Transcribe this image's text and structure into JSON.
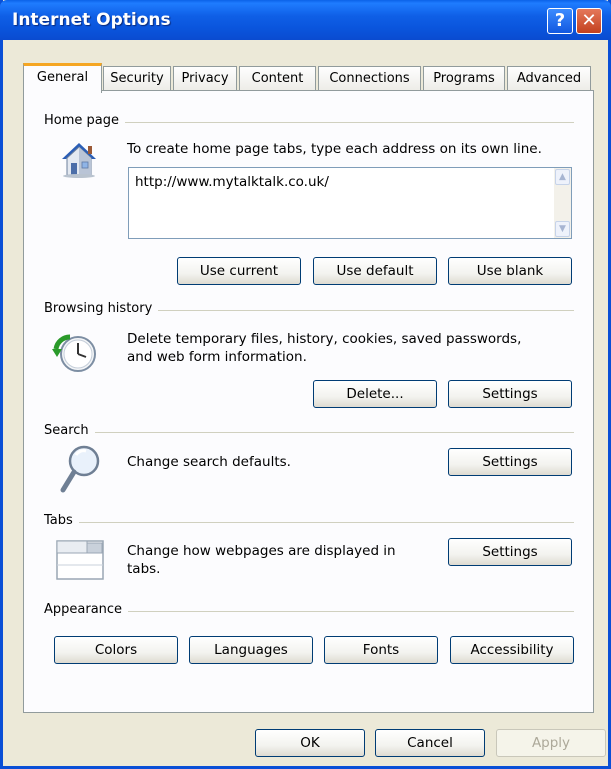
{
  "window": {
    "title": "Internet Options",
    "help_glyph": "?",
    "close_glyph": "✕"
  },
  "tabs": [
    {
      "label": "General"
    },
    {
      "label": "Security"
    },
    {
      "label": "Privacy"
    },
    {
      "label": "Content"
    },
    {
      "label": "Connections"
    },
    {
      "label": "Programs"
    },
    {
      "label": "Advanced"
    }
  ],
  "home_page": {
    "label": "Home page",
    "description": "To create home page tabs, type each address on its own line.",
    "value": "http://www.mytalktalk.co.uk/",
    "buttons": {
      "use_current": "Use current",
      "use_default": "Use default",
      "use_blank": "Use blank"
    }
  },
  "browsing_history": {
    "label": "Browsing history",
    "description_line1": "Delete temporary files, history, cookies, saved passwords,",
    "description_line2": "and web form information.",
    "buttons": {
      "delete": "Delete...",
      "settings": "Settings"
    }
  },
  "search": {
    "label": "Search",
    "description": "Change search defaults.",
    "buttons": {
      "settings": "Settings"
    }
  },
  "tabs_group": {
    "label": "Tabs",
    "description_line1": "Change how webpages are displayed in",
    "description_line2": "tabs.",
    "buttons": {
      "settings": "Settings"
    }
  },
  "appearance": {
    "label": "Appearance",
    "buttons": {
      "colors": "Colors",
      "languages": "Languages",
      "fonts": "Fonts",
      "accessibility": "Accessibility"
    }
  },
  "footer": {
    "ok": "OK",
    "cancel": "Cancel",
    "apply": "Apply"
  },
  "icons": {
    "home_page": "house-icon",
    "browsing_history": "history-clock-icon",
    "search": "magnifier-icon",
    "tabs": "tabbed-window-icon"
  }
}
